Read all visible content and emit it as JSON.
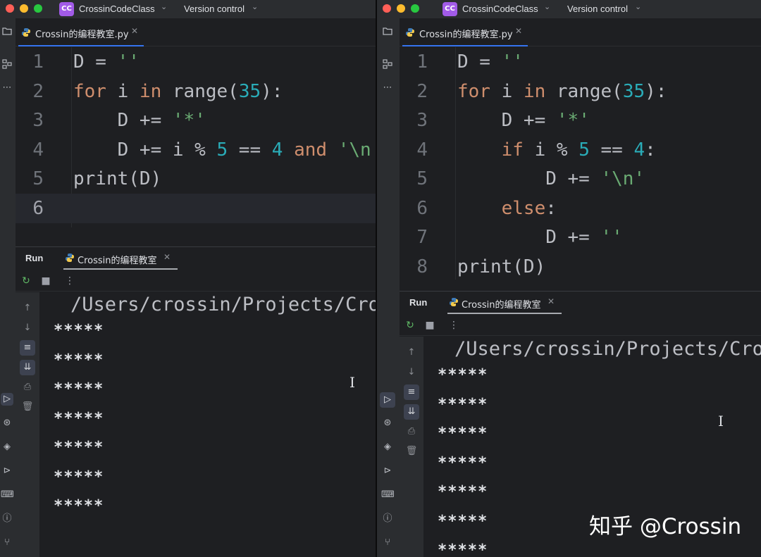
{
  "titlebar": {
    "project_badge": "CC",
    "project_name": "CrossinCodeClass",
    "menu_version_control": "Version control"
  },
  "left": {
    "tab_title": "Crossin的编程教室.py",
    "code": [
      {
        "ln": "1",
        "tokens": [
          [
            "fn",
            "D = "
          ],
          [
            "str",
            "''"
          ]
        ]
      },
      {
        "ln": "2",
        "tokens": [
          [
            "kw",
            "for"
          ],
          [
            "fn",
            " i "
          ],
          [
            "kw",
            "in"
          ],
          [
            "fn",
            " range("
          ],
          [
            "num",
            "35"
          ],
          [
            "fn",
            "):"
          ]
        ]
      },
      {
        "ln": "3",
        "tokens": [
          [
            "fn",
            "    D += "
          ],
          [
            "str",
            "'*'"
          ]
        ]
      },
      {
        "ln": "4",
        "tokens": [
          [
            "fn",
            "    D += i % "
          ],
          [
            "num",
            "5"
          ],
          [
            "fn",
            " == "
          ],
          [
            "num",
            "4"
          ],
          [
            "fn",
            " "
          ],
          [
            "kw",
            "and"
          ],
          [
            "fn",
            " "
          ],
          [
            "str",
            "'\\n'"
          ]
        ]
      },
      {
        "ln": "5",
        "tokens": [
          [
            "fn",
            "print(D)"
          ]
        ]
      },
      {
        "ln": "6",
        "tokens": []
      }
    ],
    "run": {
      "label": "Run",
      "tab_title": "Crossin的编程教室",
      "output_path": "/Users/crossin/Projects/Cros",
      "output_lines": [
        "*****",
        "*****",
        "*****",
        "*****",
        "*****",
        "*****",
        "*****"
      ]
    }
  },
  "right": {
    "tab_title": "Crossin的编程教室.py",
    "code": [
      {
        "ln": "1",
        "tokens": [
          [
            "fn",
            "D = "
          ],
          [
            "str",
            "''"
          ]
        ]
      },
      {
        "ln": "2",
        "tokens": [
          [
            "kw",
            "for"
          ],
          [
            "fn",
            " i "
          ],
          [
            "kw",
            "in"
          ],
          [
            "fn",
            " range("
          ],
          [
            "num",
            "35"
          ],
          [
            "fn",
            "):"
          ]
        ]
      },
      {
        "ln": "3",
        "tokens": [
          [
            "fn",
            "    D += "
          ],
          [
            "str",
            "'*'"
          ]
        ]
      },
      {
        "ln": "4",
        "tokens": [
          [
            "fn",
            "    "
          ],
          [
            "kw",
            "if"
          ],
          [
            "fn",
            " i % "
          ],
          [
            "num",
            "5"
          ],
          [
            "fn",
            " == "
          ],
          [
            "num",
            "4"
          ],
          [
            "fn",
            ":"
          ]
        ]
      },
      {
        "ln": "5",
        "tokens": [
          [
            "fn",
            "        D += "
          ],
          [
            "str",
            "'\\n'"
          ]
        ]
      },
      {
        "ln": "6",
        "tokens": [
          [
            "fn",
            "    "
          ],
          [
            "kw",
            "else"
          ],
          [
            "fn",
            ":"
          ]
        ]
      },
      {
        "ln": "7",
        "tokens": [
          [
            "fn",
            "        D += "
          ],
          [
            "str",
            "''"
          ]
        ]
      },
      {
        "ln": "8",
        "tokens": [
          [
            "fn",
            "print(D)"
          ]
        ]
      }
    ],
    "run": {
      "label": "Run",
      "tab_title": "Crossin的编程教室",
      "output_path": "/Users/crossin/Projects/Cros",
      "output_lines": [
        "*****",
        "*****",
        "*****",
        "*****",
        "*****",
        "*****",
        "*****"
      ]
    }
  },
  "icons": {
    "folder": "folder-icon",
    "structure": "structure-icon",
    "more": "more-icon",
    "rerun": "rerun-icon",
    "stop": "stop-icon",
    "up": "arrow-up-icon",
    "down": "arrow-down-icon",
    "softwrap": "soft-wrap-icon",
    "scroll_end": "scroll-to-end-icon",
    "print": "print-icon",
    "trash": "trash-icon",
    "run": "run-icon",
    "python": "python-console-icon",
    "layers": "services-icon",
    "play": "play-icon",
    "terminal": "terminal-icon",
    "problems": "problems-icon",
    "git": "git-icon"
  },
  "colors": {
    "background": "#1e1f22",
    "panel": "#2b2d30",
    "keyword": "#cf8e6d",
    "number": "#2aacb8",
    "string": "#6aab73",
    "text": "#bcbec4",
    "accent": "#3574f0",
    "badge": "#a25be8"
  },
  "watermark": "知乎 @Crossin"
}
